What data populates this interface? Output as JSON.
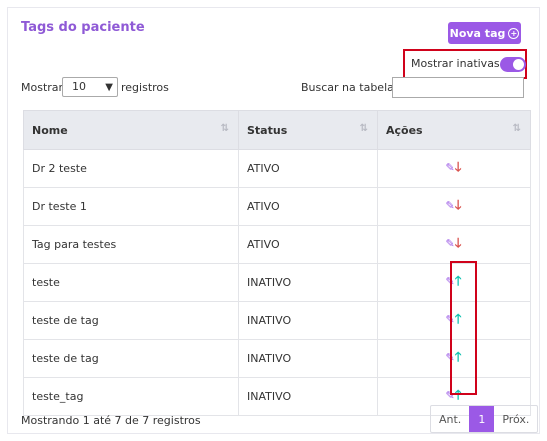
{
  "card": {
    "title": "Tags do paciente",
    "new_tag_button": "Nova tag",
    "toggle_label": "Mostrar inativas",
    "toggle_on": true
  },
  "controls": {
    "show_label": "Mostrar",
    "show_value": "10",
    "records_label": "registros",
    "search_label": "Buscar na tabela:",
    "search_value": ""
  },
  "table": {
    "headers": [
      "Nome",
      "Status",
      "Ações"
    ],
    "rows": [
      {
        "name": "Dr 2 teste",
        "status": "ATIVO",
        "action": "down"
      },
      {
        "name": "Dr teste 1",
        "status": "ATIVO",
        "action": "down"
      },
      {
        "name": "Tag para testes",
        "status": "ATIVO",
        "action": "down"
      },
      {
        "name": "teste",
        "status": "INATIVO",
        "action": "up"
      },
      {
        "name": "teste de tag",
        "status": "INATIVO",
        "action": "up"
      },
      {
        "name": "teste de tag",
        "status": "INATIVO",
        "action": "up"
      },
      {
        "name": "teste_tag",
        "status": "INATIVO",
        "action": "up"
      }
    ]
  },
  "footer": {
    "summary": "Mostrando 1 até 7 de 7 registros",
    "prev": "Ant.",
    "page": "1",
    "next": "Próx."
  },
  "colors": {
    "accent": "#9b59e6",
    "highlight": "#d0021b",
    "deactivate_arrow": "#d9534f",
    "activate_arrow": "#17c3b2"
  }
}
